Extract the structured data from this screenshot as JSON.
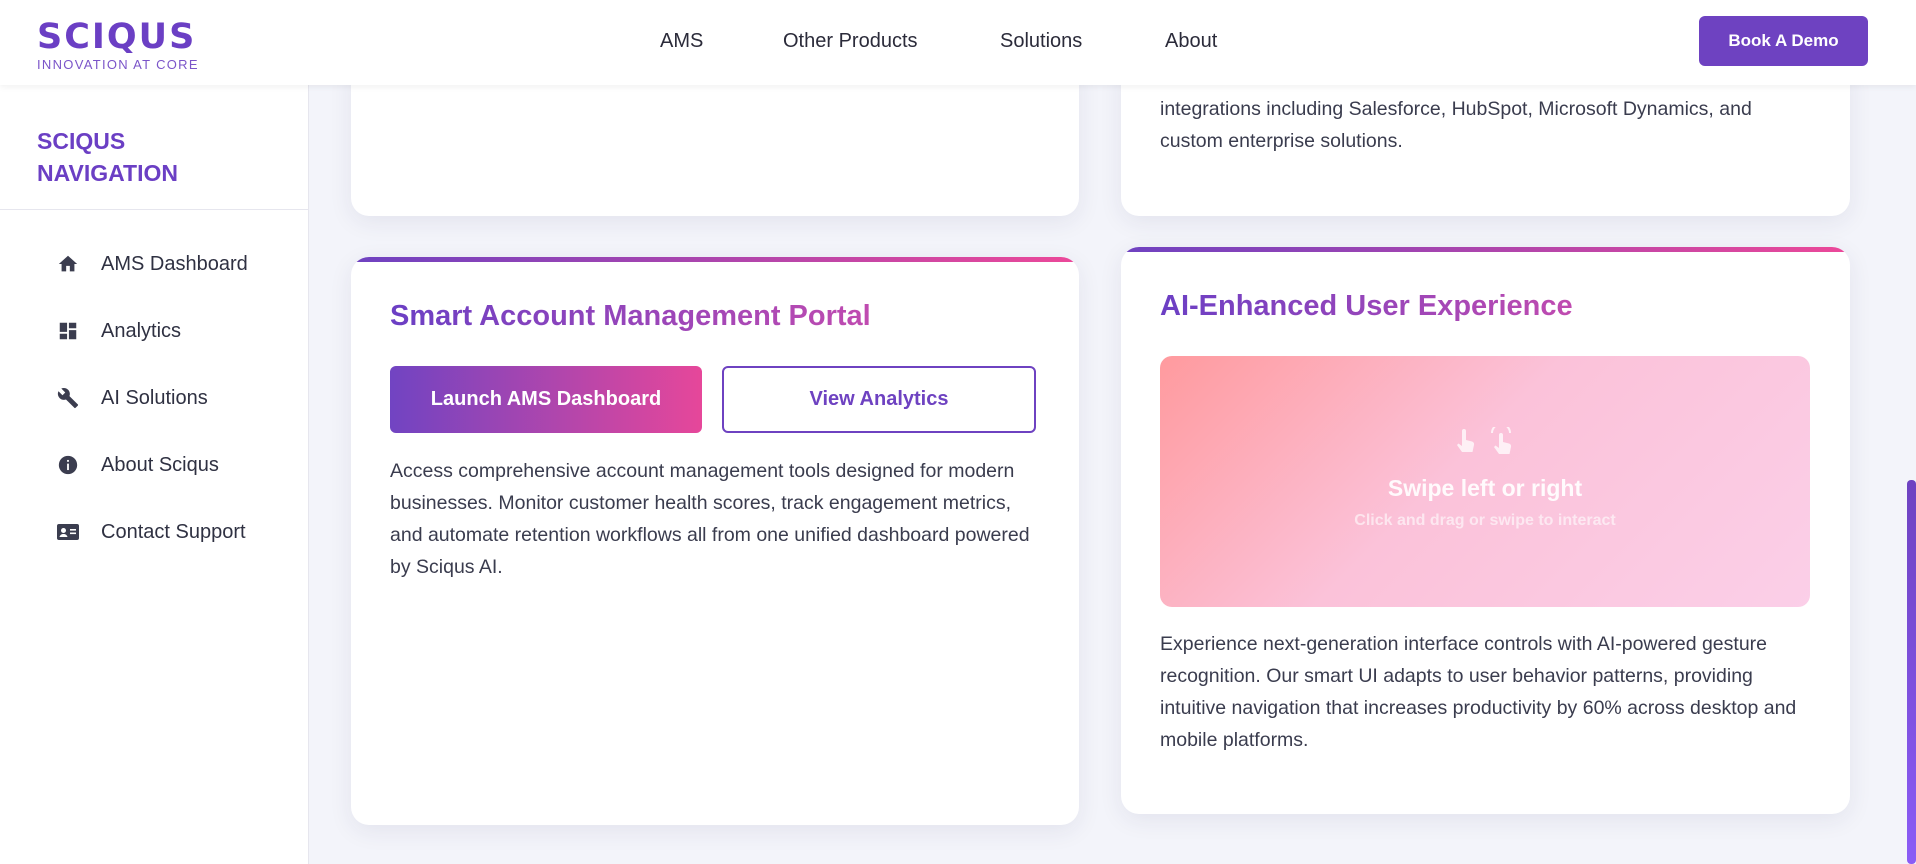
{
  "brand": {
    "name": "SCIQUS",
    "tagline": "INNOVATION AT CORE",
    "color_primary": "#6e42c1",
    "color_accent": "#ec4899"
  },
  "nav": {
    "items": [
      "AMS",
      "Other Products",
      "Solutions",
      "About"
    ],
    "cta_label": "Book A Demo"
  },
  "sidebar": {
    "title": "SCIQUS NAVIGATION",
    "items": [
      {
        "label": "AMS Dashboard",
        "icon": "home-icon"
      },
      {
        "label": "Analytics",
        "icon": "dashboard-icon"
      },
      {
        "label": "AI Solutions",
        "icon": "wrench-icon"
      },
      {
        "label": "About Sciqus",
        "icon": "info-icon"
      },
      {
        "label": "Contact Support",
        "icon": "contact-card-icon"
      }
    ]
  },
  "cards": {
    "top_right_text": "integrations including Salesforce, HubSpot, Microsoft Dynamics, and custom enterprise solutions.",
    "portal": {
      "title": "Smart Account Management Portal",
      "primary_button": "Launch AMS Dashboard",
      "secondary_button": "View Analytics",
      "description": "Access comprehensive account management tools designed for modern businesses. Monitor customer health scores, track engagement metrics, and automate retention workflows all from one unified dashboard powered by Sciqus AI."
    },
    "ux": {
      "title": "AI-Enhanced User Experience",
      "swipe_title": "Swipe left or right",
      "swipe_subtitle": "Click and drag or swipe to interact",
      "description": "Experience next-generation interface controls with AI-powered gesture recognition. Our smart UI adapts to user behavior patterns, providing intuitive navigation that increases productivity by 60% across desktop and mobile platforms."
    }
  }
}
